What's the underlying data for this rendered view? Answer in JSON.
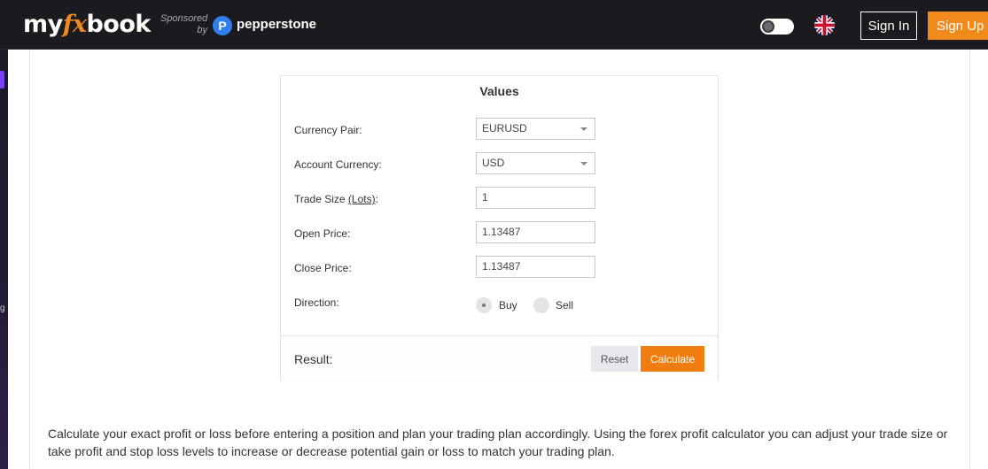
{
  "header": {
    "logo_pre": "my",
    "logo_fx": "fx",
    "logo_post": "book",
    "sponsored_line1": "Sponsored",
    "sponsored_line2": "by",
    "sponsor_name": "pepperstone",
    "theme_toggle_icon": "theme-toggle-icon",
    "flag_icon": "uk-flag-icon",
    "sign_in": "Sign In",
    "sign_up": "Sign Up",
    "accent_color": "#f08a1c"
  },
  "sidebar": {
    "glyph": "g"
  },
  "calculator": {
    "title": "Values",
    "fields": {
      "currency_pair": {
        "label": "Currency Pair:",
        "value": "EURUSD"
      },
      "account_currency": {
        "label": "Account Currency:",
        "value": "USD"
      },
      "trade_size": {
        "label_pre": "Trade Size ",
        "label_link": "(Lots)",
        "label_post": ":",
        "value": "1"
      },
      "open_price": {
        "label": "Open Price:",
        "value": "1.13487"
      },
      "close_price": {
        "label": "Close Price:",
        "value": "1.13487"
      },
      "direction": {
        "label": "Direction:",
        "options": [
          "Buy",
          "Sell"
        ],
        "selected": "Buy"
      }
    },
    "result_label": "Result:",
    "reset_label": "Reset",
    "calculate_label": "Calculate",
    "calculate_color": "#ef7d0f"
  },
  "description": "Calculate your exact profit or loss before entering a position and plan your trading plan accordingly. Using the forex profit calculator you can adjust your trade size or take profit and stop loss levels to increase or decrease potential gain or loss to match your trading plan."
}
